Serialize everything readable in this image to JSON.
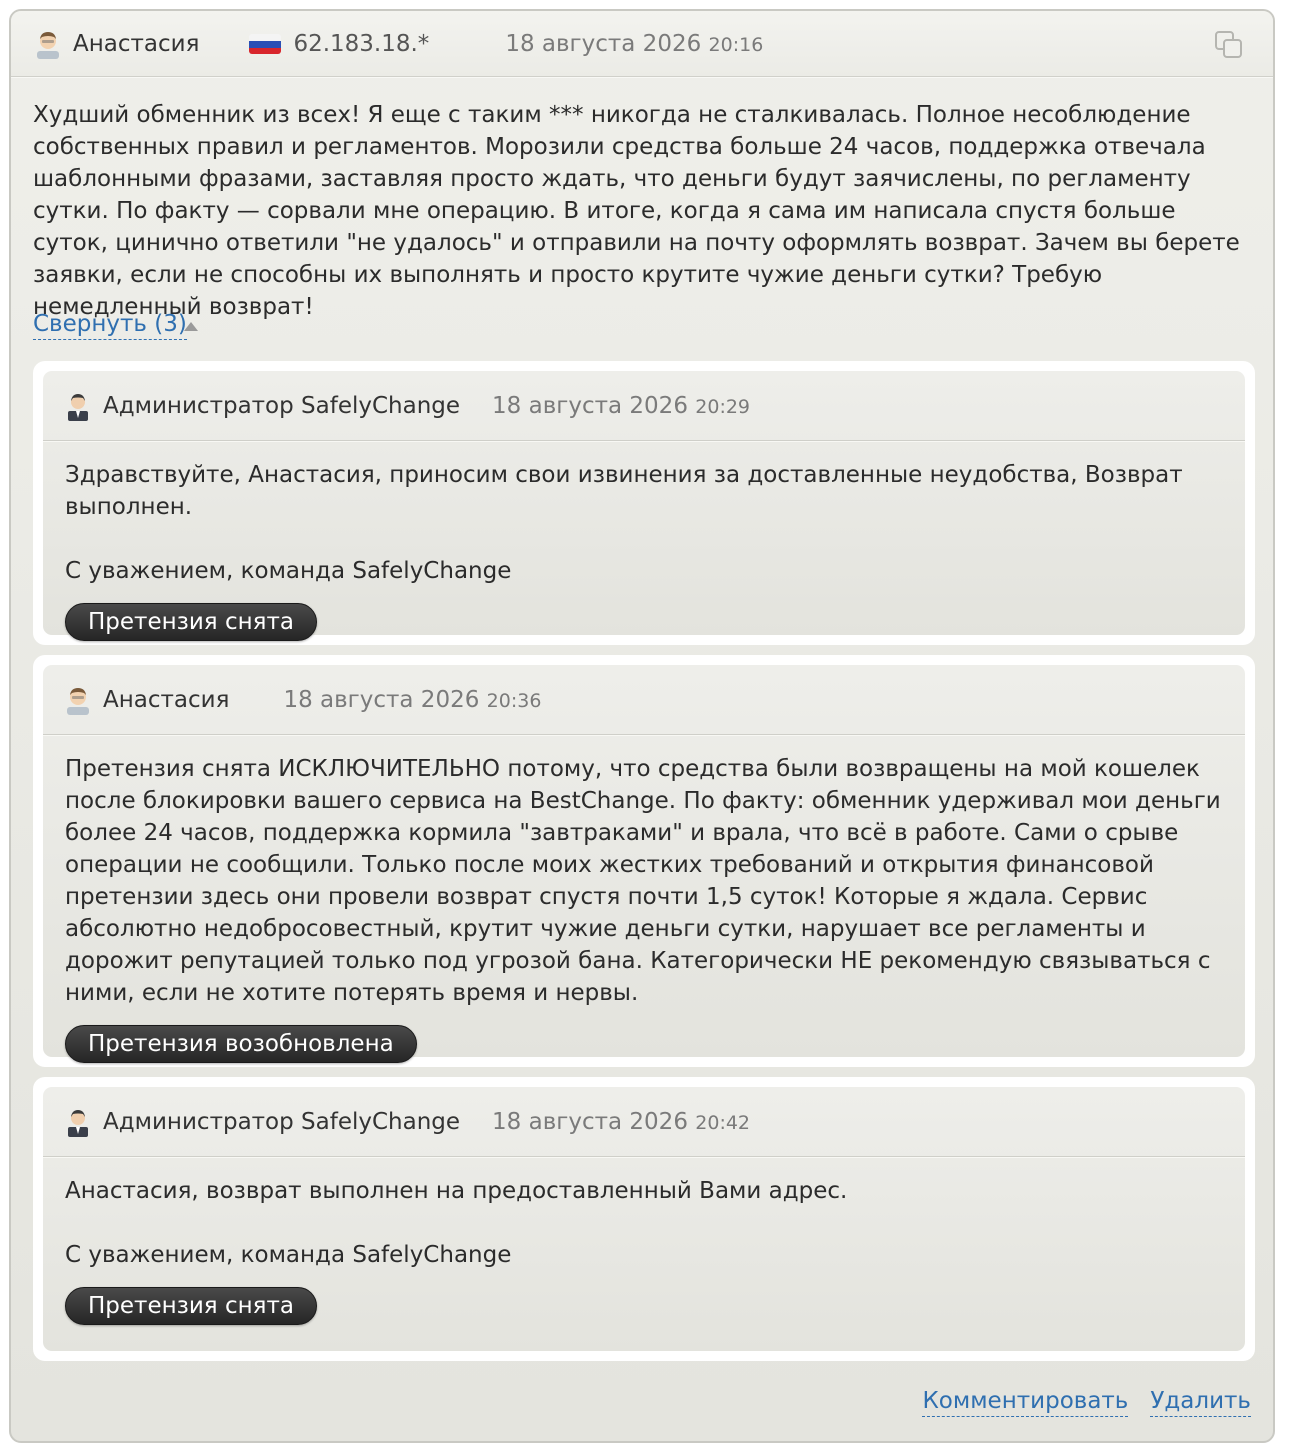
{
  "review": {
    "author": "Анастасия",
    "ip": "62.183.18.*",
    "date": "18 августа 2026",
    "time": "20:16",
    "text": "Худший обменник из всех! Я еще с таким *** никогда не сталкивалась. Полное несоблюдение собственных правил и регламентов. Морозили средства больше 24 часов, поддержка отвечала шаблонными фразами, заставляя просто ждать, что деньги будут заячислены, по регламенту сутки. По факту — сорвали мне операцию. В итоге, когда я сама им написала спустя больше суток, цинично ответили \"не удалось\" и отправили на почту оформлять возврат. Зачем вы берете заявки, если не способны их выполнять и просто крутите чужие деньги сутки? Требую немедленный возврат!",
    "collapse_label": "Свернуть (3)"
  },
  "replies": [
    {
      "author": "Администратор SafelyChange",
      "date": "18 августа 2026",
      "time": "20:29",
      "text": "Здравствуйте, Анастасия, приносим свои извинения за доставленные неудобства, Возврат выполнен.",
      "signature": "С уважением, команда SafelyChange",
      "status": "Претензия снята"
    },
    {
      "author": "Анастасия",
      "date": "18 августа 2026",
      "time": "20:36",
      "text": "Претензия снята ИСКЛЮЧИТЕЛЬНО потому, что средства были возвращены на мой кошелек после блокировки вашего сервиса на BestChange. По факту: обменник удерживал мои деньги более 24 часов, поддержка кормила \"завтраками\" и врала, что всё в работе. Сами о срыве операции не сообщили. Только после моих жестких требований и открытия финансовой претензии здесь они провели возврат спустя почти 1,5 суток! Которые я ждала. Сервис абсолютно недобросовестный, крутит чужие деньги сутки, нарушает все регламенты и дорожит репутацией только под угрозой бана. Категорически НЕ рекомендую связываться с ними, если не хотите потерять время и нервы.",
      "status": "Претензия возобновлена"
    },
    {
      "author": "Администратор SafelyChange",
      "date": "18 августа 2026",
      "time": "20:42",
      "text": "Анастасия, возврат выполнен на предоставленный Вами адрес.",
      "signature": "С уважением, команда SafelyChange",
      "status": "Претензия снята"
    }
  ],
  "footer": {
    "comment_label": "Комментировать",
    "delete_label": "Удалить"
  }
}
